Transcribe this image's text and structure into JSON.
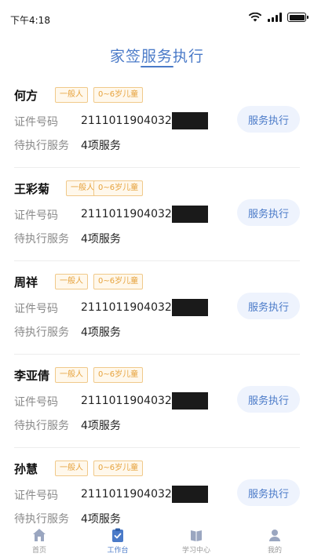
{
  "status": {
    "time": "下午4:18"
  },
  "header": {
    "title": "家签服务执行"
  },
  "labels": {
    "id": "证件号码",
    "pending": "待执行服务"
  },
  "action_label": "服务执行",
  "residents": [
    {
      "name": "何方",
      "tags": [
        "一般人",
        "0~6岁儿童"
      ],
      "id_number": "2111011904032",
      "pending": "4项服务"
    },
    {
      "name": "王彩菊",
      "tags": [
        "一般人",
        "0~6岁儿童"
      ],
      "id_number": "2111011904032",
      "pending": "4项服务"
    },
    {
      "name": "周祥",
      "tags": [
        "一般人",
        "0~6岁儿童"
      ],
      "id_number": "2111011904032",
      "pending": "4项服务"
    },
    {
      "name": "李亚倩",
      "tags": [
        "一般人",
        "0~6岁儿童"
      ],
      "id_number": "2111011904032",
      "pending": "4项服务"
    },
    {
      "name": "孙慧",
      "tags": [
        "一般人",
        "0~6岁儿童"
      ],
      "id_number": "2111011904032",
      "pending": "4项服务"
    }
  ],
  "tabs": [
    {
      "label": "首页",
      "icon": "home-icon"
    },
    {
      "label": "工作台",
      "icon": "clipboard-icon"
    },
    {
      "label": "学习中心",
      "icon": "book-icon"
    },
    {
      "label": "我的",
      "icon": "user-icon"
    }
  ],
  "colors": {
    "accent": "#4a7ac8",
    "tag": "#e6a23c"
  }
}
